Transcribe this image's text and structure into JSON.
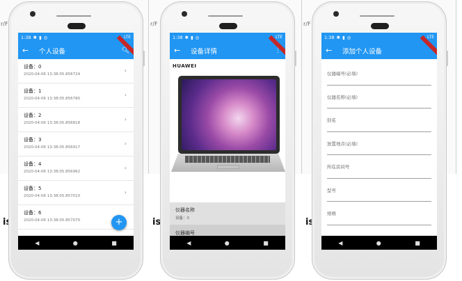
{
  "background": {
    "strips": [
      {
        "label": "r/F"
      },
      {
        "label": "r/F"
      },
      {
        "label": "r/F"
      }
    ],
    "side_labels": [
      "is",
      "is",
      "is"
    ]
  },
  "phones": {
    "status_time": "1:38",
    "status_right": "LTE",
    "device_list": {
      "title": "个人设备",
      "back_icon": "arrow-back-icon",
      "action_icon": "search-icon",
      "items": [
        {
          "title": "设备：0",
          "subtitle": "2020-04-06 13:38:05.856724"
        },
        {
          "title": "设备：1",
          "subtitle": "2020-04-06 13:38:05.856780"
        },
        {
          "title": "设备：2",
          "subtitle": "2020-04-06 13:38:05.856818"
        },
        {
          "title": "设备：3",
          "subtitle": "2020-04-06 13:38:05.856917"
        },
        {
          "title": "设备：4",
          "subtitle": "2020-04-06 13:38:05.856962"
        },
        {
          "title": "设备：5",
          "subtitle": "2020-04-06 13:38:05.857010"
        },
        {
          "title": "设备：6",
          "subtitle": "2020-04-06 13:38:05.857070"
        }
      ],
      "fab_label": "+"
    },
    "device_detail": {
      "title": "设备详情",
      "back_icon": "arrow-back-icon",
      "action_icon": "more-vert-icon",
      "brand": "HUAWEI",
      "fields": [
        {
          "label": "仪器名称",
          "value": "设备：0"
        },
        {
          "label": "仪器编号",
          "value": ""
        }
      ]
    },
    "add_device": {
      "title": "添加个人设备",
      "back_icon": "arrow-back-icon",
      "fields": [
        {
          "placeholder": "仪器编号(必填)"
        },
        {
          "placeholder": "仪器名称(必填)"
        },
        {
          "placeholder": "别名"
        },
        {
          "placeholder": "放置地点(必填)"
        },
        {
          "placeholder": "所在房间号"
        },
        {
          "placeholder": "型号"
        },
        {
          "placeholder": "规格"
        }
      ]
    },
    "nav": {
      "back": "◀",
      "home": "●",
      "recents": "■"
    }
  },
  "colors": {
    "primary": "#2196f3",
    "debug_ribbon": "#c62828"
  }
}
